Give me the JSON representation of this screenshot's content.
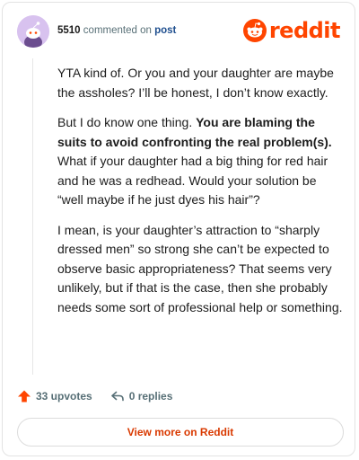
{
  "comment": {
    "username": "5510",
    "action_text": "commented on",
    "post_link": "post",
    "paragraph_1": "YTA kind of. Or you and your daughter are maybe the assholes? I’ll be honest, I don’t know exactly.",
    "paragraph_2_start": "But I do know one thing. ",
    "paragraph_2_bold": "You are blaming the suits to avoid confronting the real problem(s).",
    "paragraph_2_end": " What if your daughter had a big thing for red hair and he was a redhead. Would your solution be “well maybe if he just dyes his hair”?",
    "paragraph_3": "I mean, is your daughter’s attraction to “sharply dressed men” so strong she can’t be expected to observe basic appropriateness? That seems very unlikely, but if that is the case, then she probably needs some sort of professional help or something."
  },
  "brand": {
    "logo_text": "reddit",
    "color": "#ff4500"
  },
  "actions": {
    "upvotes_label": "33 upvotes",
    "replies_label": "0 replies",
    "upvote_icon": "upvote-arrow-icon",
    "reply_icon": "reply-arrow-icon"
  },
  "footer": {
    "view_more_label": "View more on Reddit"
  }
}
